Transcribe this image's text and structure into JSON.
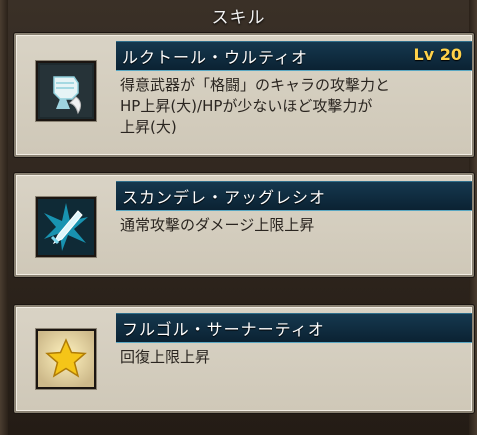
{
  "header": {
    "title": "スキル"
  },
  "skills": [
    {
      "name": "ルクトール・ウルティオ",
      "level": "Lv 20",
      "icon": "fist-claw-icon",
      "description": "得意武器が「格闘」のキャラの攻撃力と\nHP上昇(大)/HPが少ないほど攻撃力が\n上昇(大)"
    },
    {
      "name": "スカンデレ・アッグレシオ",
      "level": "",
      "icon": "blade-burst-icon",
      "description": "通常攻撃のダメージ上限上昇"
    },
    {
      "name": "フルゴル・サーナーティオ",
      "level": "",
      "icon": "star-icon",
      "description": "回復上限上昇"
    }
  ]
}
